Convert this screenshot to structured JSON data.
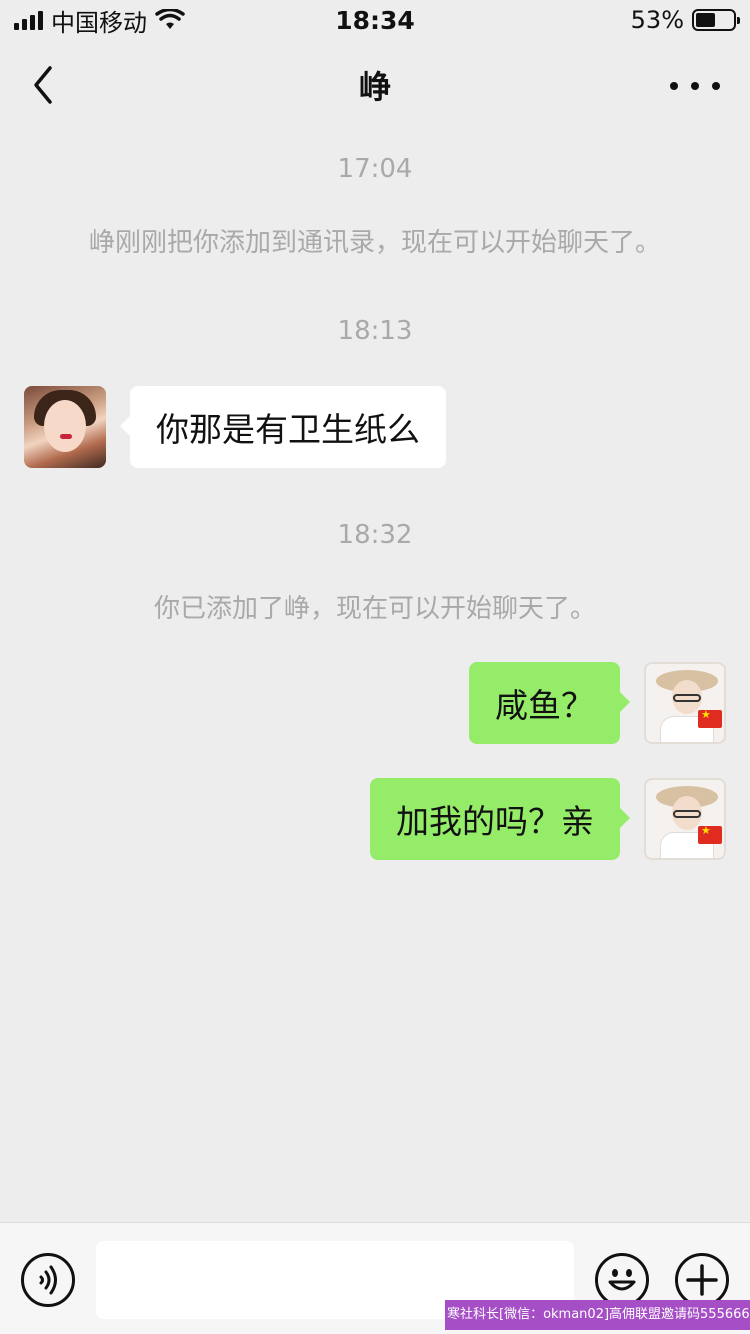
{
  "status_bar": {
    "carrier": "中国移动",
    "time": "18:34",
    "battery_text": "53%",
    "battery_level": 0.53
  },
  "nav": {
    "title": "峥",
    "back_icon": "chevron-left-icon",
    "more_icon": "more-dots-icon"
  },
  "messages": [
    {
      "type": "time",
      "text": "17:04"
    },
    {
      "type": "system",
      "text": "峥刚刚把你添加到通讯录，现在可以开始聊天了。"
    },
    {
      "type": "time",
      "text": "18:13"
    },
    {
      "type": "incoming",
      "text": "你那是有卫生纸么"
    },
    {
      "type": "time",
      "text": "18:32"
    },
    {
      "type": "system",
      "text": "你已添加了峥，现在可以开始聊天了。"
    },
    {
      "type": "outgoing",
      "text": "咸鱼？"
    },
    {
      "type": "outgoing",
      "text": "加我的吗？亲"
    }
  ],
  "input_bar": {
    "text_value": "",
    "voice_icon": "voice-icon",
    "emoji_icon": "emoji-icon",
    "plus_icon": "plus-icon"
  },
  "watermark": "寒社科长[微信：okman02]高佣联盟邀请码555666",
  "colors": {
    "background": "#ededed",
    "outgoing_bubble": "#95ec69",
    "incoming_bubble": "#ffffff",
    "system_text": "#a9a9a9"
  }
}
